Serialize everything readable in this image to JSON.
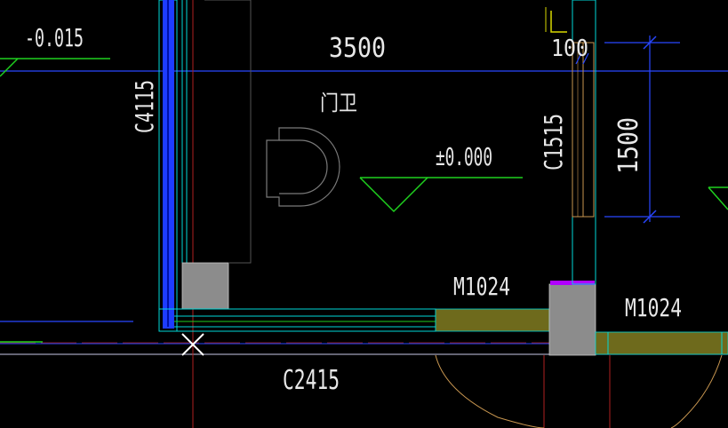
{
  "drawing": {
    "labels": {
      "elev_left": "-0.015",
      "dim_width": "3500",
      "room_name": "门卫",
      "dim_wall": "100",
      "window_left": "C4115",
      "elev_center": "±0.000",
      "window_right": "C1515",
      "dim_height": "1500",
      "door_a": "M1024",
      "door_b": "M1024",
      "window_bottom": "C2415"
    }
  },
  "colors": {
    "background": "#000000",
    "wall_blue": "#1e3cff",
    "wall_cyan": "#00d8d8",
    "axis_blue": "#2846ff",
    "elevation_green": "#1fd11f",
    "door_fill": "#6e6a1c",
    "column_gray": "#8c8c8c",
    "grid_red": "#b02020",
    "window_tan": "#c89650",
    "yellow": "#d8d800",
    "magenta": "#b000ff"
  }
}
